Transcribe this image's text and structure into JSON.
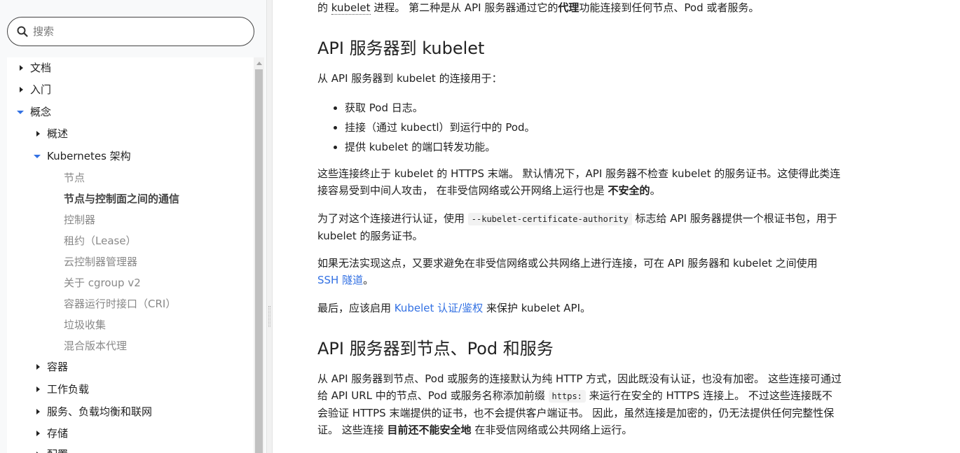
{
  "search": {
    "placeholder": "搜索"
  },
  "nav": {
    "docs": "文档",
    "getting_started": "入门",
    "concepts": "概念",
    "overview": "概述",
    "architecture": "Kubernetes 架构",
    "arch_children": [
      "节点",
      "节点与控制面之间的通信",
      "控制器",
      "租约（Lease）",
      "云控制器管理器",
      "关于 cgroup v2",
      "容器运行时接口（CRI）",
      "垃圾收集",
      "混合版本代理"
    ],
    "containers": "容器",
    "workloads": "工作负载",
    "services": "服务、负载均衡和联网",
    "storage": "存储",
    "config": "配置"
  },
  "content": {
    "intro_line": {
      "a": "的 ",
      "kubelet": "kubelet",
      "b": " 进程。 第二种是从 API 服务器通过它的",
      "proxy": "代理",
      "c": "功能连接到任何节点、Pod 或者服务。"
    },
    "h_kubelet": "API 服务器到 kubelet",
    "p_used_for": "从 API 服务器到 kubelet 的连接用于：",
    "bullets": [
      "获取 Pod 日志。",
      "挂接（通过 kubectl）到运行中的 Pod。",
      "提供 kubelet 的端口转发功能。"
    ],
    "p_terminate": {
      "a": "这些连接终止于 kubelet 的 HTTPS 末端。 默认情况下，API 服务器不检查 kubelet 的服务证书。这使得此类连接容易受到中间人攻击， 在非受信网络或公开网络上运行也是 ",
      "bold": "不安全的",
      "b": "。"
    },
    "p_verify": {
      "a": "为了对这个连接进行认证，使用 ",
      "code": "--kubelet-certificate-authority",
      "b": " 标志给 API 服务器提供一个根证书包，用于 kubelet 的服务证书。"
    },
    "p_ssh": {
      "a": "如果无法实现这点，又要求避免在非受信网络或公共网络上进行连接，可在 API 服务器和 kubelet 之间使用 ",
      "link": "SSH 隧道",
      "b": "。"
    },
    "p_auth": {
      "a": "最后，应该启用 ",
      "link": "Kubelet 认证/鉴权",
      "b": " 来保护 kubelet API。"
    },
    "h_nodes": "API 服务器到节点、Pod 和服务",
    "p_nodes": {
      "a": "从 API 服务器到节点、Pod 或服务的连接默认为纯 HTTP 方式，因此既没有认证，也没有加密。 这些连接可通过给 API URL 中的节点、Pod 或服务名称添加前缀 ",
      "code": "https:",
      "b": " 来运行在安全的 HTTPS 连接上。 不过这些连接既不会验证 HTTPS 末端提供的证书，也不会提供客户端证书。 因此，虽然连接是加密的，仍无法提供任何完整性保证。 这些连接 ",
      "bold": "目前还不能安全地",
      "c": " 在非受信网络或公共网络上运行。"
    }
  }
}
